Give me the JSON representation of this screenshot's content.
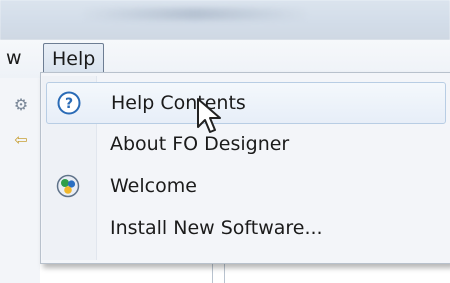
{
  "menubar": {
    "partial_menu_label": "w",
    "help_menu_label": "Help"
  },
  "help_menu": {
    "items": [
      {
        "label": "Help Contents",
        "icon": "help-question-icon",
        "highlighted": true
      },
      {
        "label": "About FO Designer",
        "icon": "",
        "highlighted": false
      },
      {
        "label": "Welcome",
        "icon": "welcome-circles-icon",
        "highlighted": false
      },
      {
        "label": "Install New Software...",
        "icon": "",
        "highlighted": false
      }
    ]
  },
  "colors": {
    "accent_help_icon": "#2a6bb6",
    "highlight_border": "#b8cde4",
    "menu_background": "#f3f5f9"
  }
}
